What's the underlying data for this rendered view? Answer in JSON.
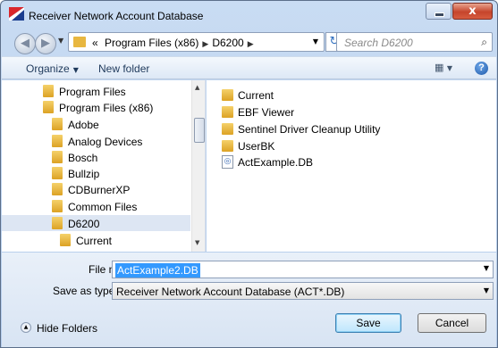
{
  "window": {
    "title": "Receiver Network Account Database",
    "close_glyph": "x"
  },
  "address": {
    "history_glyph": "«",
    "crumbs": [
      "Program Files (x86)",
      "D6200"
    ],
    "search_placeholder": "Search D6200"
  },
  "toolbar": {
    "organize_label": "Organize",
    "new_folder_label": "New folder",
    "help_glyph": "?"
  },
  "nav_tree": {
    "items": [
      {
        "label": "Program Files"
      },
      {
        "label": "Program Files (x86)"
      },
      {
        "label": "Adobe"
      },
      {
        "label": "Analog Devices"
      },
      {
        "label": "Bosch"
      },
      {
        "label": "Bullzip"
      },
      {
        "label": "CDBurnerXP"
      },
      {
        "label": "Common Files"
      },
      {
        "label": "D6200",
        "selected": true
      },
      {
        "label": "Current"
      }
    ]
  },
  "files": {
    "items": [
      {
        "label": "Current",
        "type": "folder"
      },
      {
        "label": "EBF Viewer",
        "type": "folder"
      },
      {
        "label": "Sentinel Driver Cleanup Utility",
        "type": "folder"
      },
      {
        "label": "UserBK",
        "type": "folder"
      },
      {
        "label": "ActExample.DB",
        "type": "file"
      }
    ]
  },
  "form": {
    "file_name_label": "File name:",
    "file_name_value": "ActExample2.DB",
    "save_type_label": "Save as type:",
    "save_type_value": "Receiver Network Account Database (ACT*.DB)"
  },
  "footer": {
    "hide_folders_label": "Hide Folders",
    "save_label": "Save",
    "cancel_label": "Cancel"
  },
  "colors": {
    "selection": "#3399ff",
    "folder": "#e8b740",
    "close_button": "#c6452c"
  }
}
